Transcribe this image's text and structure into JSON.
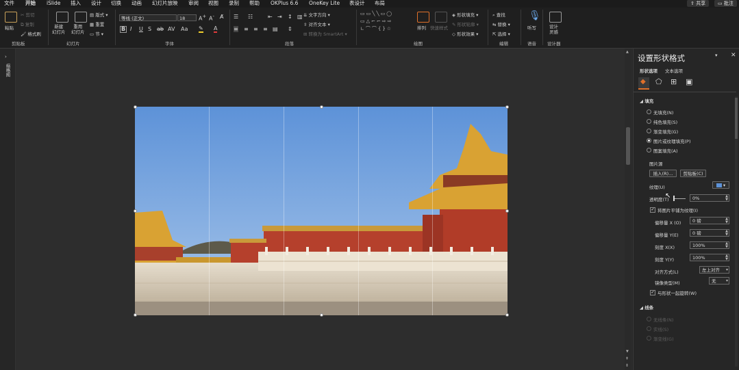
{
  "menu": {
    "tabs": [
      "文件",
      "开始",
      "iSlide",
      "插入",
      "设计",
      "切换",
      "动画",
      "幻灯片放映",
      "审阅",
      "视图",
      "录制",
      "帮助",
      "OKPlus 6.6",
      "OneKey Lite",
      "表设计",
      "布局"
    ],
    "active": "开始",
    "share": "共享",
    "comment": "批注"
  },
  "ribbon": {
    "clipboard": {
      "paste": "粘贴",
      "cut": "剪切",
      "copy": "复制",
      "format_painter": "格式刷",
      "label": "剪贴板"
    },
    "slides": {
      "new": "新建\n幻灯片",
      "reuse": "重用\n幻灯片",
      "layout": "版式",
      "reset": "重置",
      "section": "节",
      "label": "幻灯片"
    },
    "font": {
      "name": "等线 (正文)",
      "size": "18",
      "label": "字体"
    },
    "paragraph": {
      "text_direction": "文字方向",
      "align_text": "对齐文本",
      "smartart": "转换为 SmartArt",
      "label": "段落"
    },
    "drawing": {
      "arrange": "排列",
      "quick_styles": "快速样式",
      "fill": "形状填充",
      "outline": "形状轮廓",
      "effects": "形状效果",
      "label": "绘图"
    },
    "editing": {
      "find": "查找",
      "replace": "替换",
      "select": "选择",
      "label": "编辑"
    },
    "voice": {
      "dictate": "听写",
      "label": "语音"
    },
    "designer": {
      "ideas": "设计\n灵感",
      "label": "设计器"
    }
  },
  "left_panel": {
    "label": "缩略图"
  },
  "pane": {
    "title": "设置形状格式",
    "tabs": [
      "形状选项",
      "文本选项"
    ],
    "fill_section": "填充",
    "fill_options": [
      {
        "label": "无填充(N)",
        "selected": false
      },
      {
        "label": "纯色填充(S)",
        "selected": false
      },
      {
        "label": "渐变填充(G)",
        "selected": false
      },
      {
        "label": "图片或纹理填充(P)",
        "selected": true
      },
      {
        "label": "图案填充(A)",
        "selected": false
      }
    ],
    "picture_source": "图片源",
    "insert_btn": "插入(R)...",
    "clipboard_btn": "剪贴板(C)",
    "texture_label": "纹理(U)",
    "transparency_label": "透明度(T)",
    "transparency_value": "0%",
    "tile_label": "将图片平铺为纹理(I)",
    "offset_x_label": "偏移量 X (O)",
    "offset_x_value": "0 磅",
    "offset_y_label": "偏移量 Y(E)",
    "offset_y_value": "0 磅",
    "scale_x_label": "刻度 X(X)",
    "scale_x_value": "100%",
    "scale_y_label": "刻度 Y(Y)",
    "scale_y_value": "100%",
    "alignment_label": "对齐方式(L)",
    "alignment_value": "左上对齐",
    "mirror_label": "镜像类型(M)",
    "mirror_value": "无",
    "rotate_label": "与形状一起旋转(W)",
    "line_section": "线条",
    "line_options": [
      "无线条(N)",
      "实线(S)",
      "渐变线(G)"
    ]
  },
  "colors": {
    "accent": "#e0702a",
    "bg": "#262626",
    "sky": "#5d92d8",
    "wall": "#b5402c",
    "roof": "#d9a233"
  }
}
